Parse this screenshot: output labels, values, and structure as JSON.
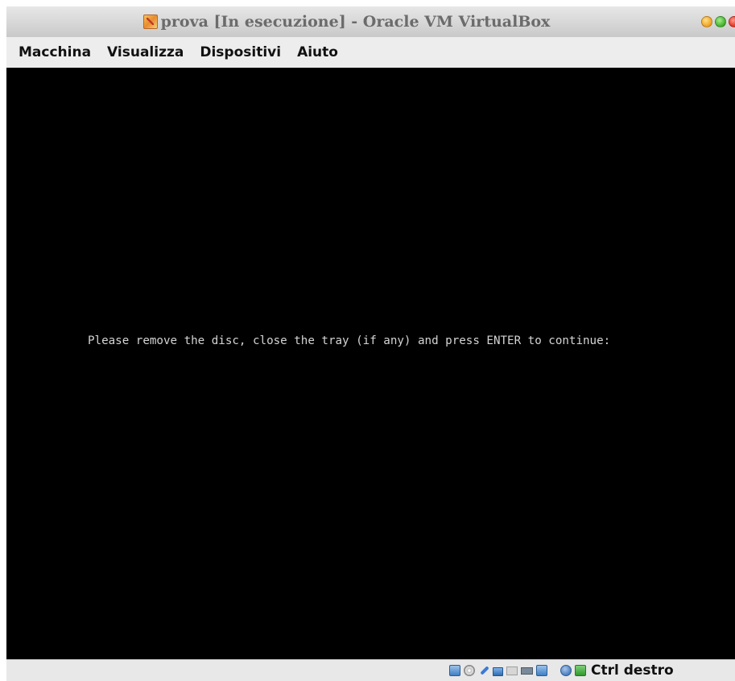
{
  "window": {
    "title": "prova [In esecuzione] - Oracle VM VirtualBox"
  },
  "menu": {
    "items": [
      "Macchina",
      "Visualizza",
      "Dispositivi",
      "Aiuto"
    ]
  },
  "vm_screen": {
    "console_text": "Please remove the disc, close the tray (if any) and press ENTER to continue:"
  },
  "statusbar": {
    "icons": [
      "hard-disk-icon",
      "optical-drive-icon",
      "usb-icon",
      "network-icon",
      "shared-folders-icon",
      "video-capture-icon",
      "display-icon",
      "mouse-integration-icon",
      "keyboard-icon"
    ],
    "host_key_label": "Ctrl destro"
  },
  "colors": {
    "vm_background": "#000000",
    "console_text": "#d4d4d4",
    "title_text": "#6b6b6b"
  }
}
